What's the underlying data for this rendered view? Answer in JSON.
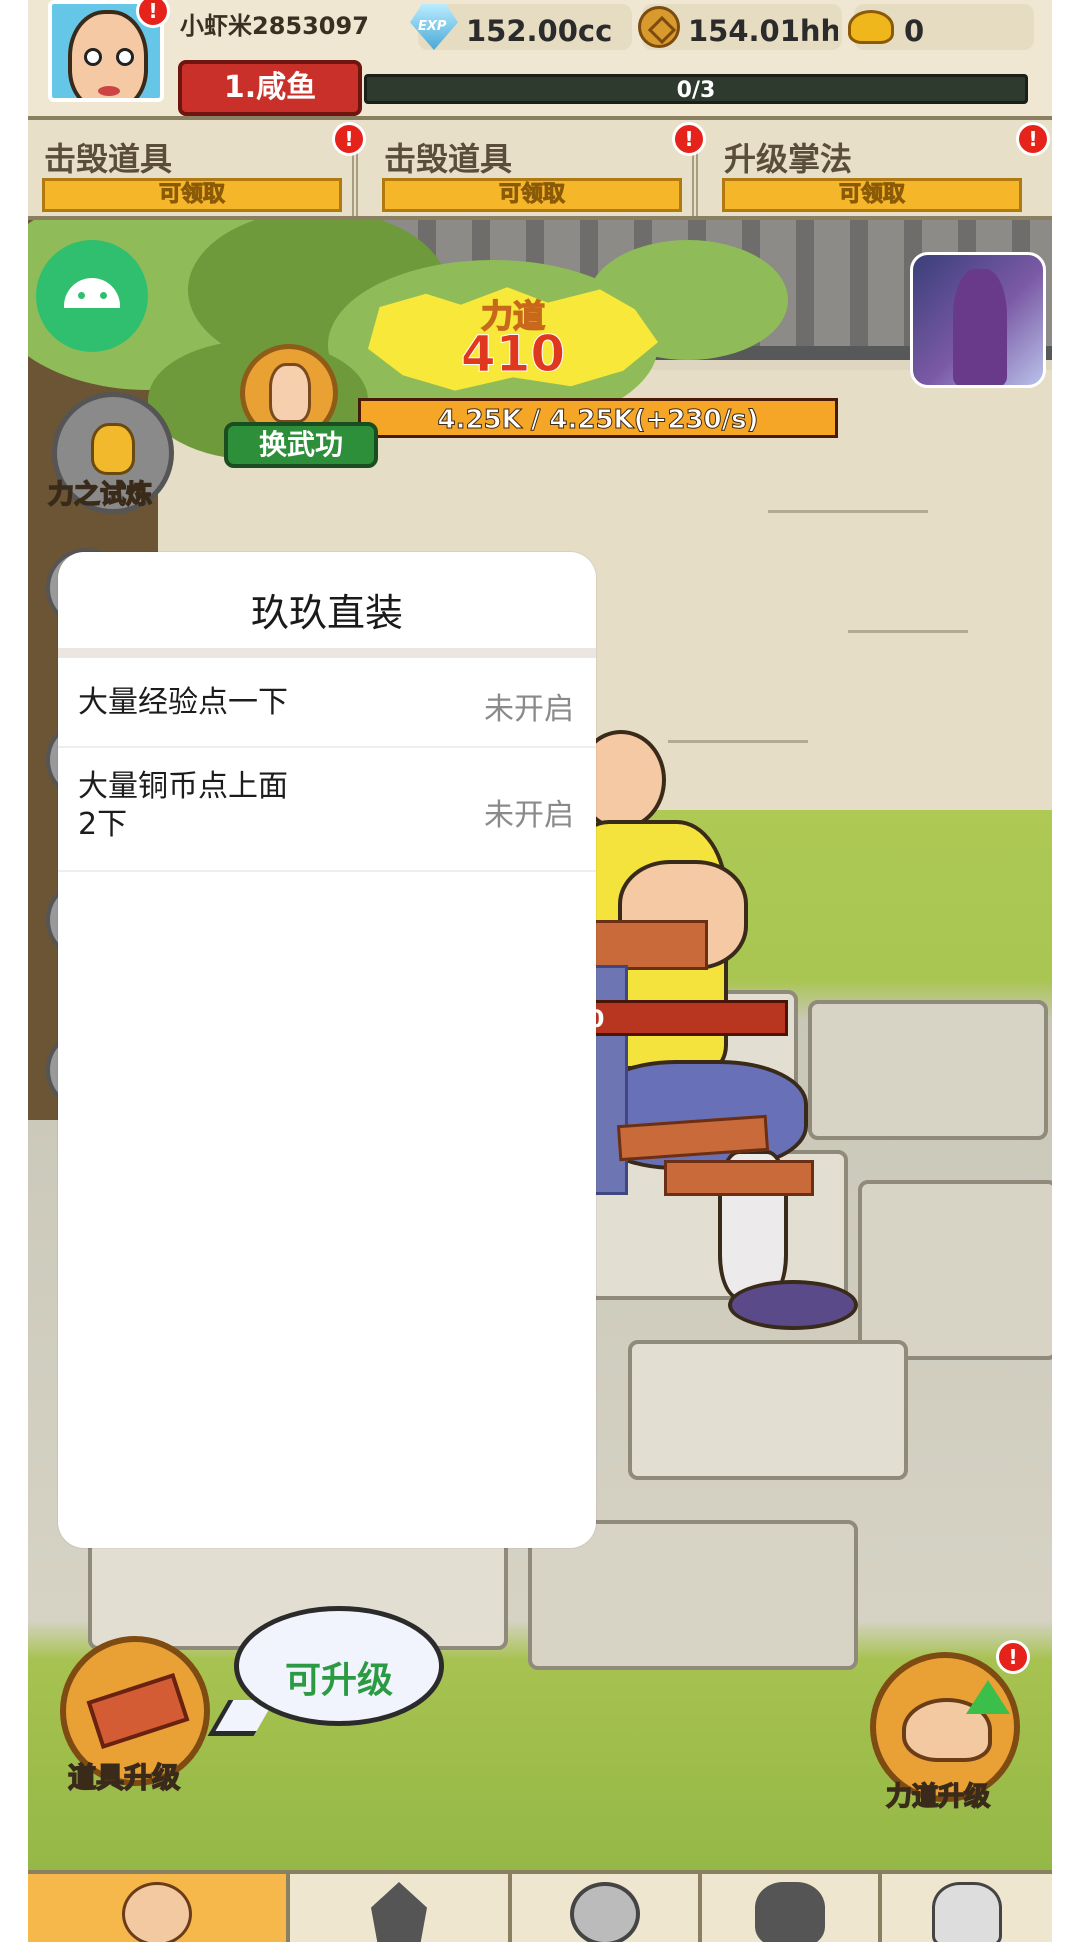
{
  "player": {
    "username": "小虾米2853097",
    "rank": "1.咸鱼",
    "rank_progress_text": "0/3",
    "rank_progress": 0
  },
  "resources": {
    "exp_icon_text": "EXP",
    "exp": "152.00cc",
    "copper": "154.01hh",
    "gold": "0"
  },
  "tasks": [
    {
      "title": "击毁道具",
      "button": "可领取"
    },
    {
      "title": "击毁道具",
      "button": "可领取"
    },
    {
      "title": "升级掌法",
      "button": "可领取"
    }
  ],
  "game": {
    "power_label": "力道",
    "power_value": "410",
    "hp_text": "4.25K / 4.25K(+230/s)",
    "hp_fraction": 1.0,
    "swap_skill": "换武功",
    "trial_label": "力之试炼",
    "target_hp_partial": "00"
  },
  "bottom": {
    "item_upgrade": "道具升级",
    "bubble": "可升级",
    "power_upgrade": "力道升级"
  },
  "modal": {
    "title": "玖玖直装",
    "options": [
      {
        "label": "大量经验点一下",
        "status": "未开启"
      },
      {
        "label_line1": "大量铜币点上面",
        "label_line2": "2下",
        "status": "未开启"
      }
    ]
  },
  "badges": {
    "mark": "!"
  },
  "colors": {
    "accent_orange": "#f6b62a",
    "rank_red": "#c9302a",
    "status_gray": "#8a8a8a",
    "badge_red": "#e5231a"
  }
}
